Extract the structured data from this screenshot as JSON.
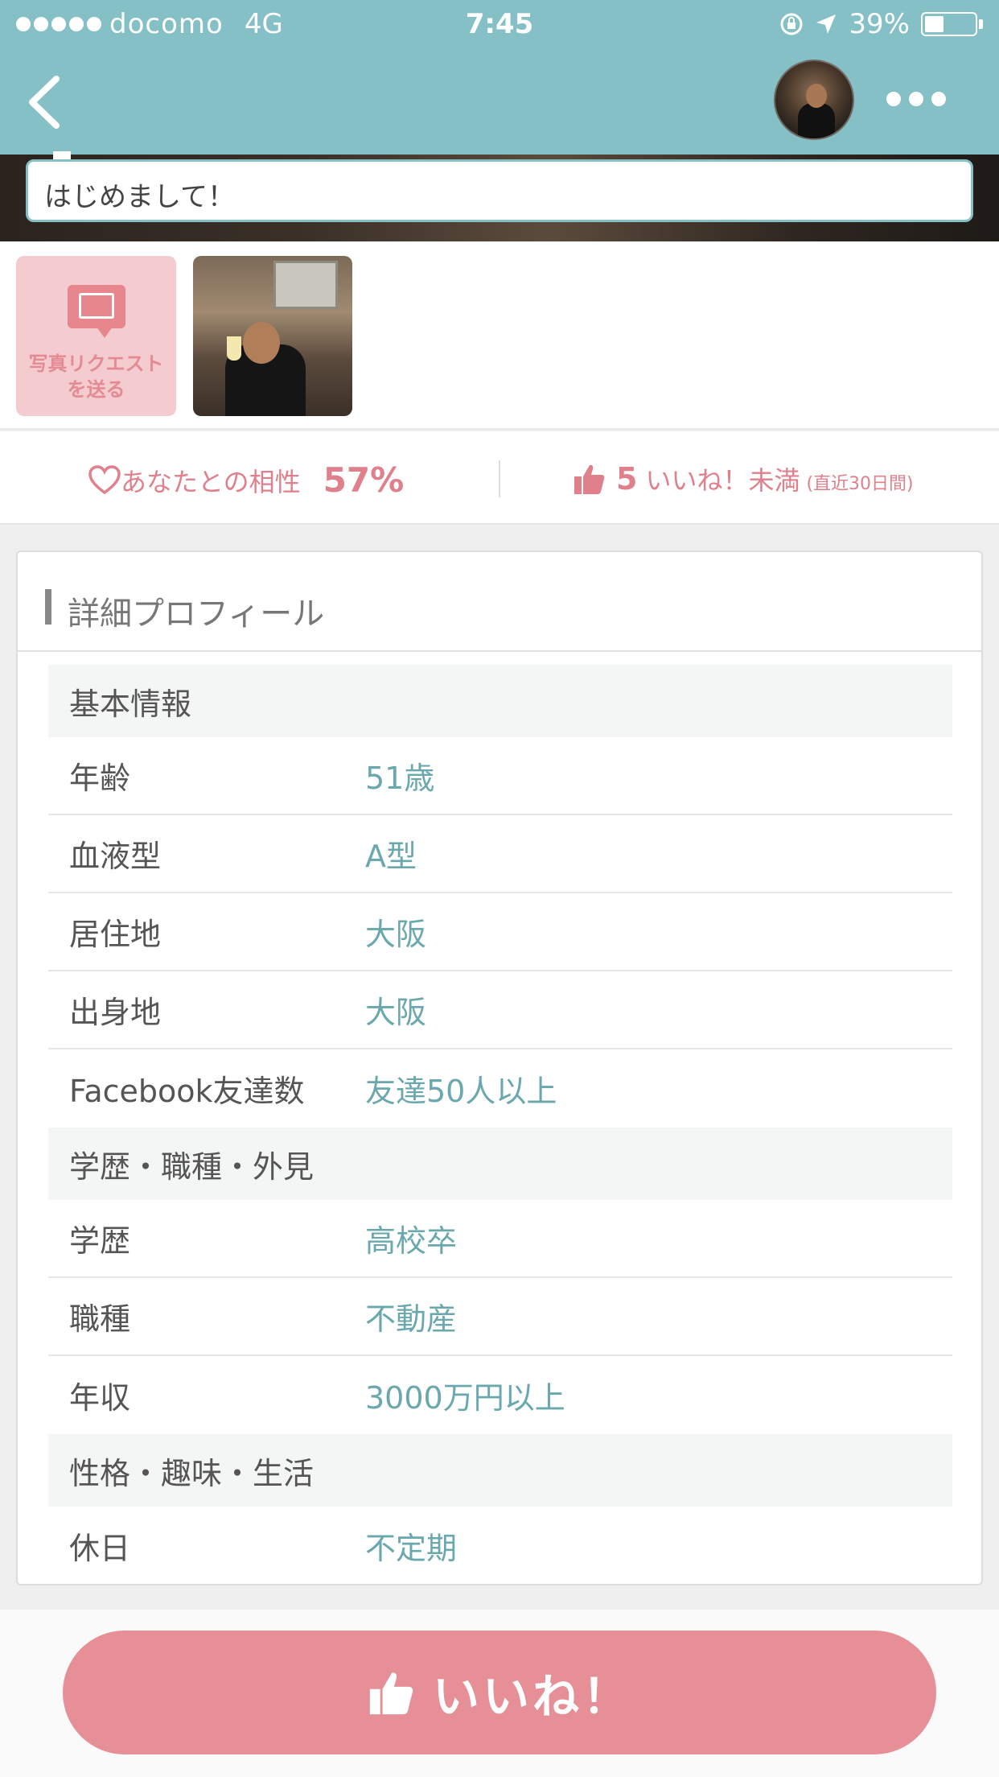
{
  "status_bar": {
    "carrier": "docomo",
    "network": "4G",
    "time": "7:45",
    "battery": "39%",
    "battery_level": 0.39
  },
  "message": {
    "text": "はじめまして！"
  },
  "photos": {
    "request_label_line1": "写真リクエスト",
    "request_label_line2": "を送る"
  },
  "compat": {
    "label": "あなたとの相性",
    "percent": "57%",
    "like_count": "5",
    "like_label": "いいね！未満",
    "like_period": "(直近30日間)"
  },
  "profile": {
    "title": "詳細プロフィール",
    "sections": [
      {
        "label": "基本情報",
        "rows": [
          {
            "key": "年齢",
            "value": "51歳"
          },
          {
            "key": "血液型",
            "value": "A型"
          },
          {
            "key": "居住地",
            "value": "大阪"
          },
          {
            "key": "出身地",
            "value": "大阪"
          },
          {
            "key": "Facebook友達数",
            "value": "友達50人以上"
          }
        ]
      },
      {
        "label": "学歴・職種・外見",
        "rows": [
          {
            "key": "学歴",
            "value": "高校卒"
          },
          {
            "key": "職種",
            "value": "不動産"
          },
          {
            "key": "年収",
            "value": "3000万円以上"
          }
        ]
      },
      {
        "label": "性格・趣味・生活",
        "rows": [
          {
            "key": "休日",
            "value": "不定期"
          }
        ]
      }
    ]
  },
  "like_button": {
    "label": "いいね！"
  },
  "colors": {
    "header": "#84c0c6",
    "accent_pink": "#e68f96",
    "value_teal": "#6aa8ad"
  }
}
